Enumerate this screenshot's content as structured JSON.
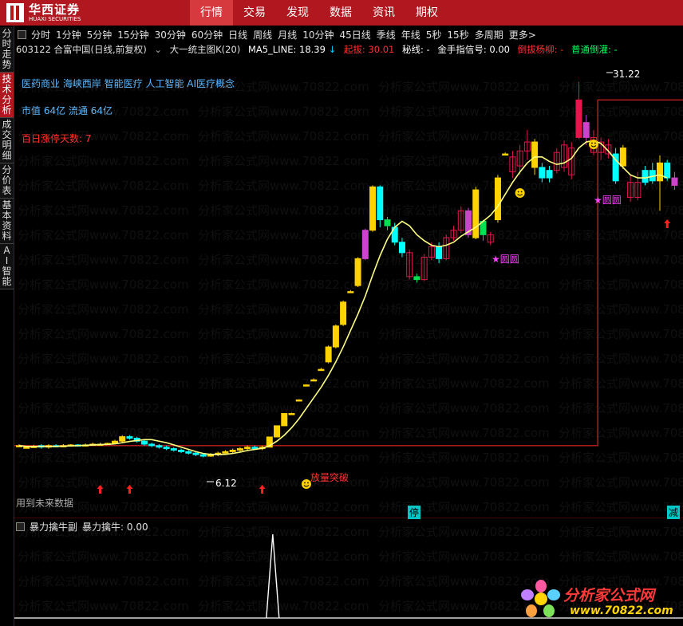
{
  "brand": {
    "name_cn": "华西证券",
    "name_en": "HUAXI SECURITIES"
  },
  "top_nav": [
    "行情",
    "交易",
    "发现",
    "数据",
    "资讯",
    "期权"
  ],
  "side_tabs": [
    "分时走势",
    "技术分析",
    "成交明细",
    "分价表",
    "基本资料",
    "AI智能"
  ],
  "periods": [
    "分时",
    "1分钟",
    "5分钟",
    "15分钟",
    "30分钟",
    "60分钟",
    "日线",
    "周线",
    "月线",
    "10分钟",
    "45日线",
    "季线",
    "年线",
    "5秒",
    "15秒",
    "多周期",
    "更多>"
  ],
  "info_bar": {
    "stock": "603122 合富中国(日线,前复权)",
    "indicator": "大一统主图K(20)",
    "ma": "MA5_LINE: 18.39",
    "ma_arrow": "↓",
    "qiao": "起拔: 30.01",
    "mi": "秘线: -",
    "jin": "金手指信号: 0.00",
    "dao": "倒拔杨柳: -",
    "pu": "普通倒灌: -"
  },
  "overlays": {
    "concepts": "医药商业 海峡西岸 智能医疗 人工智能 AI医疗概念",
    "market_cap": "市值 64亿   流通 64亿",
    "limit_days": "百日涨停天数: 7",
    "breakout": "放量突破",
    "star1": "★圆圆",
    "star2": "★圆圆",
    "high_label": "31.22",
    "low_label": "6.12",
    "future_note": "用到未来数据",
    "ting": "停",
    "jian": "减"
  },
  "sub_panel": {
    "title": "暴力擒牛副",
    "value_label": "暴力擒牛: 0.00"
  },
  "watermark": "分析家公式网www.70822.com",
  "site_brand": {
    "name": "分析家公式网",
    "url": "www.70822.com"
  },
  "colors": {
    "up": "#ffd200",
    "down": "#00ffff",
    "bull_red": "#e8154c",
    "magenta": "#cc44cc",
    "green": "#00e050",
    "ma_line": "#ffff80",
    "stair": "#c02020",
    "header": "#b0171f"
  },
  "chart_data": {
    "type": "candlestick",
    "ma_label": "MA5_LINE",
    "price_range": [
      6.12,
      31.22
    ],
    "candles": [
      {
        "o": 6.9,
        "c": 6.9,
        "h": 7.0,
        "l": 6.8,
        "k": "up"
      },
      {
        "o": 6.8,
        "c": 6.8,
        "h": 6.9,
        "l": 6.7,
        "k": "up"
      },
      {
        "o": 6.85,
        "c": 6.85,
        "h": 6.95,
        "l": 6.75,
        "k": "up"
      },
      {
        "o": 6.9,
        "c": 6.8,
        "h": 7.0,
        "l": 6.7,
        "k": "down"
      },
      {
        "o": 6.8,
        "c": 6.9,
        "h": 7.0,
        "l": 6.7,
        "k": "up"
      },
      {
        "o": 6.9,
        "c": 6.85,
        "h": 7.0,
        "l": 6.8,
        "k": "down"
      },
      {
        "o": 6.85,
        "c": 6.9,
        "h": 7.0,
        "l": 6.8,
        "k": "up"
      },
      {
        "o": 6.9,
        "c": 6.95,
        "h": 7.0,
        "l": 6.85,
        "k": "up"
      },
      {
        "o": 6.95,
        "c": 6.9,
        "h": 7.0,
        "l": 6.85,
        "k": "down"
      },
      {
        "o": 6.9,
        "c": 6.95,
        "h": 7.05,
        "l": 6.85,
        "k": "up"
      },
      {
        "o": 6.95,
        "c": 7.0,
        "h": 7.1,
        "l": 6.9,
        "k": "up"
      },
      {
        "o": 7.0,
        "c": 7.0,
        "h": 7.1,
        "l": 6.95,
        "k": "up"
      },
      {
        "o": 7.0,
        "c": 7.05,
        "h": 7.1,
        "l": 6.95,
        "k": "up"
      },
      {
        "o": 7.05,
        "c": 7.2,
        "h": 7.3,
        "l": 7.0,
        "k": "up"
      },
      {
        "o": 7.2,
        "c": 7.5,
        "h": 7.6,
        "l": 7.1,
        "k": "up"
      },
      {
        "o": 7.5,
        "c": 7.4,
        "h": 7.6,
        "l": 7.3,
        "k": "down"
      },
      {
        "o": 7.4,
        "c": 7.2,
        "h": 7.5,
        "l": 7.1,
        "k": "down"
      },
      {
        "o": 7.2,
        "c": 7.0,
        "h": 7.3,
        "l": 6.9,
        "k": "down"
      },
      {
        "o": 7.0,
        "c": 6.9,
        "h": 7.1,
        "l": 6.8,
        "k": "down"
      },
      {
        "o": 6.9,
        "c": 6.8,
        "h": 7.0,
        "l": 6.7,
        "k": "down"
      },
      {
        "o": 6.8,
        "c": 6.7,
        "h": 6.9,
        "l": 6.6,
        "k": "down"
      },
      {
        "o": 6.7,
        "c": 6.6,
        "h": 6.8,
        "l": 6.5,
        "k": "down"
      },
      {
        "o": 6.6,
        "c": 6.5,
        "h": 6.7,
        "l": 6.4,
        "k": "down"
      },
      {
        "o": 6.5,
        "c": 6.4,
        "h": 6.6,
        "l": 6.3,
        "k": "down"
      },
      {
        "o": 6.4,
        "c": 6.3,
        "h": 6.5,
        "l": 6.2,
        "k": "down"
      },
      {
        "o": 6.3,
        "c": 6.2,
        "h": 6.4,
        "l": 6.12,
        "k": "down"
      },
      {
        "o": 6.2,
        "c": 6.3,
        "h": 6.4,
        "l": 6.15,
        "k": "up"
      },
      {
        "o": 6.3,
        "c": 6.4,
        "h": 6.5,
        "l": 6.2,
        "k": "up"
      },
      {
        "o": 6.4,
        "c": 6.5,
        "h": 6.6,
        "l": 6.3,
        "k": "up"
      },
      {
        "o": 6.5,
        "c": 6.6,
        "h": 6.7,
        "l": 6.4,
        "k": "up"
      },
      {
        "o": 6.6,
        "c": 6.7,
        "h": 6.8,
        "l": 6.5,
        "k": "up"
      },
      {
        "o": 6.7,
        "c": 6.8,
        "h": 6.9,
        "l": 6.6,
        "k": "up"
      },
      {
        "o": 6.8,
        "c": 6.7,
        "h": 6.9,
        "l": 6.6,
        "k": "down"
      },
      {
        "o": 6.7,
        "c": 6.8,
        "h": 6.9,
        "l": 6.6,
        "k": "up"
      },
      {
        "o": 6.8,
        "c": 7.48,
        "h": 7.48,
        "l": 6.8,
        "k": "up"
      },
      {
        "o": 7.48,
        "c": 8.23,
        "h": 8.23,
        "l": 7.48,
        "k": "up"
      },
      {
        "o": 8.23,
        "c": 9.05,
        "h": 9.05,
        "l": 8.23,
        "k": "up"
      },
      {
        "o": 9.05,
        "c": 9.05,
        "h": 9.1,
        "l": 9.0,
        "k": "up"
      },
      {
        "o": 9.96,
        "c": 9.96,
        "h": 10.0,
        "l": 9.9,
        "k": "up"
      },
      {
        "o": 10.96,
        "c": 10.96,
        "h": 11.0,
        "l": 10.9,
        "k": "up"
      },
      {
        "o": 11.3,
        "c": 11.3,
        "h": 11.4,
        "l": 11.2,
        "k": "up"
      },
      {
        "o": 12.0,
        "c": 12.0,
        "h": 12.1,
        "l": 11.9,
        "k": "up"
      },
      {
        "o": 12.5,
        "c": 13.5,
        "h": 13.6,
        "l": 12.4,
        "k": "up"
      },
      {
        "o": 13.5,
        "c": 14.9,
        "h": 15.0,
        "l": 13.4,
        "k": "up"
      },
      {
        "o": 15.0,
        "c": 16.5,
        "h": 16.6,
        "l": 14.9,
        "k": "up"
      },
      {
        "o": 17.2,
        "c": 17.2,
        "h": 17.3,
        "l": 17.1,
        "k": "up"
      },
      {
        "o": 17.6,
        "c": 19.4,
        "h": 19.5,
        "l": 17.5,
        "k": "up"
      },
      {
        "o": 19.4,
        "c": 21.3,
        "h": 21.4,
        "l": 19.3,
        "k": "magenta"
      },
      {
        "o": 21.3,
        "c": 24.2,
        "h": 24.3,
        "l": 21.2,
        "k": "up"
      },
      {
        "o": 24.2,
        "c": 22.0,
        "h": 24.3,
        "l": 21.5,
        "k": "down"
      },
      {
        "o": 22.0,
        "c": 21.6,
        "h": 22.2,
        "l": 21.3,
        "k": "green"
      },
      {
        "o": 21.5,
        "c": 20.5,
        "h": 21.8,
        "l": 20.3,
        "k": "down"
      },
      {
        "o": 20.5,
        "c": 19.8,
        "h": 20.8,
        "l": 19.5,
        "k": "down"
      },
      {
        "o": 19.8,
        "c": 18.2,
        "h": 20.0,
        "l": 18.0,
        "k": "red"
      },
      {
        "o": 18.2,
        "c": 18.0,
        "h": 18.4,
        "l": 17.8,
        "k": "green"
      },
      {
        "o": 18.0,
        "c": 19.5,
        "h": 19.7,
        "l": 17.9,
        "k": "red"
      },
      {
        "o": 19.5,
        "c": 20.2,
        "h": 20.5,
        "l": 19.3,
        "k": "red"
      },
      {
        "o": 20.2,
        "c": 19.4,
        "h": 20.5,
        "l": 19.1,
        "k": "down"
      },
      {
        "o": 19.4,
        "c": 20.8,
        "h": 21.0,
        "l": 19.3,
        "k": "red"
      },
      {
        "o": 20.8,
        "c": 21.3,
        "h": 21.6,
        "l": 20.6,
        "k": "red"
      },
      {
        "o": 21.3,
        "c": 22.6,
        "h": 22.9,
        "l": 21.1,
        "k": "red"
      },
      {
        "o": 22.6,
        "c": 21.0,
        "h": 22.8,
        "l": 20.8,
        "k": "magenta"
      },
      {
        "o": 20.8,
        "c": 24.0,
        "h": 24.2,
        "l": 20.7,
        "k": "up"
      },
      {
        "o": 21.0,
        "c": 21.9,
        "h": 22.0,
        "l": 20.6,
        "k": "green"
      },
      {
        "o": 21.0,
        "c": 20.5,
        "h": 21.2,
        "l": 20.3,
        "k": "red"
      },
      {
        "o": 22.0,
        "c": 24.8,
        "h": 25.0,
        "l": 21.8,
        "k": "up"
      },
      {
        "o": 26.4,
        "c": 26.4,
        "h": 26.5,
        "l": 26.3,
        "k": "up"
      },
      {
        "o": 25.2,
        "c": 26.2,
        "h": 26.6,
        "l": 24.8,
        "k": "red"
      },
      {
        "o": 25.6,
        "c": 26.6,
        "h": 27.0,
        "l": 25.0,
        "k": "red"
      },
      {
        "o": 26.6,
        "c": 27.2,
        "h": 28.0,
        "l": 26.0,
        "k": "red"
      },
      {
        "o": 27.2,
        "c": 25.5,
        "h": 27.4,
        "l": 25.0,
        "k": "up"
      },
      {
        "o": 25.5,
        "c": 24.8,
        "h": 25.8,
        "l": 24.5,
        "k": "down"
      },
      {
        "o": 24.8,
        "c": 25.3,
        "h": 25.6,
        "l": 24.5,
        "k": "down"
      },
      {
        "o": 25.3,
        "c": 26.5,
        "h": 26.8,
        "l": 25.1,
        "k": "red"
      },
      {
        "o": 25.5,
        "c": 27.0,
        "h": 27.3,
        "l": 25.2,
        "k": "red"
      },
      {
        "o": 26.8,
        "c": 25.0,
        "h": 27.2,
        "l": 24.7,
        "k": "red"
      },
      {
        "o": 27.5,
        "c": 30.01,
        "h": 31.22,
        "l": 27.4,
        "k": "bull"
      },
      {
        "o": 28.5,
        "c": 27.5,
        "h": 29.0,
        "l": 27.0,
        "k": "magenta"
      },
      {
        "o": 27.5,
        "c": 26.5,
        "h": 28.0,
        "l": 26.3,
        "k": "red"
      },
      {
        "o": 26.5,
        "c": 27.2,
        "h": 27.5,
        "l": 26.0,
        "k": "red"
      },
      {
        "o": 27.0,
        "c": 26.4,
        "h": 27.4,
        "l": 26.1,
        "k": "red"
      },
      {
        "o": 26.4,
        "c": 24.6,
        "h": 26.8,
        "l": 24.4,
        "k": "down"
      },
      {
        "o": 25.6,
        "c": 26.8,
        "h": 27.0,
        "l": 25.4,
        "k": "up"
      },
      {
        "o": 24.5,
        "c": 23.5,
        "h": 25.0,
        "l": 23.2,
        "k": "red"
      },
      {
        "o": 23.5,
        "c": 24.5,
        "h": 25.2,
        "l": 23.3,
        "k": "red"
      },
      {
        "o": 24.5,
        "c": 25.3,
        "h": 25.6,
        "l": 24.3,
        "k": "down"
      },
      {
        "o": 25.3,
        "c": 24.6,
        "h": 25.8,
        "l": 24.4,
        "k": "down"
      },
      {
        "o": 24.6,
        "c": 25.8,
        "h": 26.3,
        "l": 22.6,
        "k": "up"
      },
      {
        "o": 25.8,
        "c": 24.8,
        "h": 26.0,
        "l": 24.6,
        "k": "down"
      },
      {
        "o": 24.8,
        "c": 24.3,
        "h": 25.2,
        "l": 24.0,
        "k": "magenta"
      }
    ],
    "ma5": [
      6.9,
      6.85,
      6.85,
      6.85,
      6.85,
      6.85,
      6.87,
      6.88,
      6.9,
      6.92,
      6.95,
      6.97,
      6.98,
      7.02,
      7.1,
      7.18,
      7.25,
      7.3,
      7.3,
      7.2,
      7.1,
      6.95,
      6.8,
      6.65,
      6.5,
      6.38,
      6.32,
      6.3,
      6.32,
      6.38,
      6.47,
      6.58,
      6.65,
      6.72,
      6.9,
      7.2,
      7.6,
      8.1,
      8.7,
      9.4,
      10.1,
      10.8,
      11.6,
      12.5,
      13.5,
      14.6,
      15.7,
      16.9,
      18.3,
      19.6,
      20.7,
      21.5,
      21.9,
      21.6,
      21.0,
      20.6,
      20.3,
      20.2,
      20.3,
      20.5,
      20.9,
      21.2,
      21.5,
      21.9,
      22.3,
      22.9,
      23.7,
      24.5,
      25.2,
      25.8,
      26.2,
      26.2,
      25.9,
      25.7,
      25.8,
      26.1,
      26.8,
      27.2,
      27.3,
      27.1,
      26.6,
      26.0,
      25.5,
      25.0,
      24.8,
      24.8,
      24.9,
      25.0,
      24.8
    ]
  },
  "sub_chart_data": {
    "type": "line",
    "series_label": "暴力擒牛",
    "spike_index": 34,
    "value": 0.0
  }
}
